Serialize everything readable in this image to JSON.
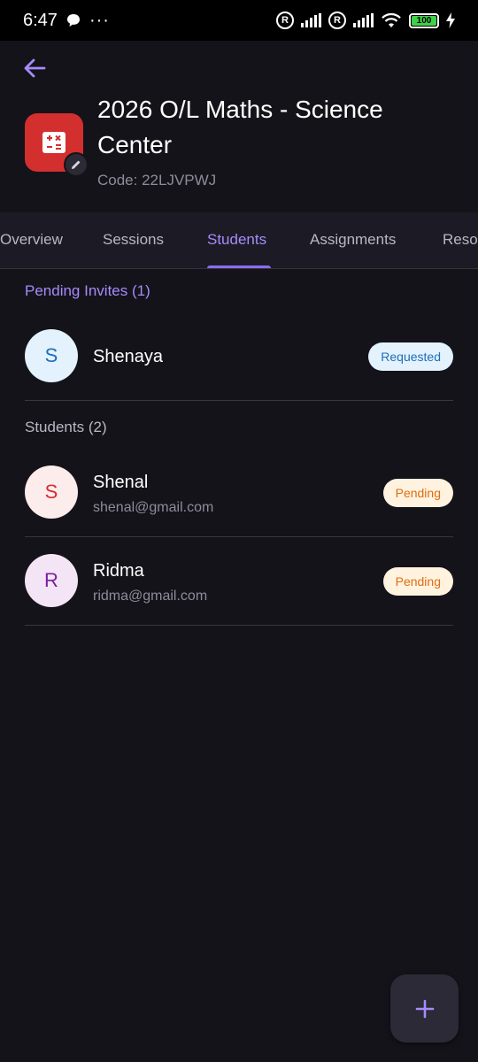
{
  "status_bar": {
    "time": "6:47",
    "battery": "100"
  },
  "header": {
    "title": "2026 O/L Maths - Science Center",
    "code": "Code: 22LJVPWJ"
  },
  "tabs": [
    {
      "label": "Overview",
      "active": false
    },
    {
      "label": "Sessions",
      "active": false
    },
    {
      "label": "Students",
      "active": true
    },
    {
      "label": "Assignments",
      "active": false
    },
    {
      "label": "Reso",
      "active": false
    }
  ],
  "pending_section": {
    "label": "Pending Invites (1)",
    "items": [
      {
        "initial": "S",
        "name": "Shenaya",
        "status": "Requested"
      }
    ]
  },
  "students_section": {
    "label": "Students (2)",
    "items": [
      {
        "initial": "S",
        "name": "Shenal",
        "email": "shenal@gmail.com",
        "status": "Pending"
      },
      {
        "initial": "R",
        "name": "Ridma",
        "email": "ridma@gmail.com",
        "status": "Pending"
      }
    ]
  },
  "colors": {
    "accent": "#a78bfa",
    "app_icon": "#d32f2f",
    "requested_badge_bg": "#e3f2fd",
    "requested_badge_text": "#1e6fb8",
    "pending_badge_bg": "#fff3e0",
    "pending_badge_text": "#e06b10"
  },
  "icons": {
    "back": "arrow-left-icon",
    "app": "calculator-icon",
    "edit": "pencil-icon",
    "fab": "plus-icon"
  }
}
